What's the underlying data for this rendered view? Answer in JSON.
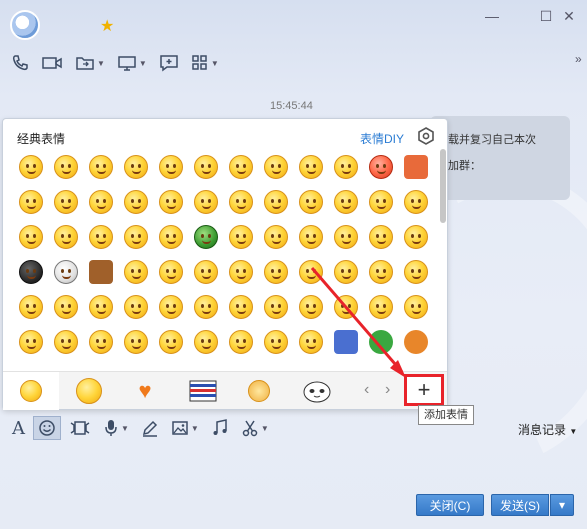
{
  "header": {
    "title": ""
  },
  "toolbar": {
    "more": "»"
  },
  "chat": {
    "timestamp": "15:45:44",
    "bubble_line1": "载并复习自己本次",
    "bubble_line2": "加群："
  },
  "emoji_panel": {
    "title": "经典表情",
    "diy_label": "表情DIY",
    "tooltip": "添加表情",
    "add_label": "+",
    "rows": [
      [
        "smile",
        "grin-shy",
        "heart-eyes",
        "grimace",
        "cool",
        "cry",
        "laugh",
        "bandage",
        "sleepy",
        "sweat",
        "angry-red",
        "gift"
      ],
      [
        "tongue",
        "big-grin",
        "dizzy",
        "worry",
        "sunglasses",
        "nervous",
        "devil",
        "yawn",
        "think",
        "shy",
        "hug",
        "wow"
      ],
      [
        "wink",
        "smug",
        "furious",
        "sweat-smile",
        "laugh-tears",
        "army-helmet",
        "ninja",
        "scream",
        "question",
        "shh",
        "spiral",
        "grumble"
      ],
      [
        "skull-bomb",
        "white-skull",
        "hammer",
        "sad",
        "sob",
        "peace",
        "frown",
        "stare",
        "puke",
        "blush",
        "kiss",
        "cheer"
      ],
      [
        "pout",
        "facepalm",
        "love",
        "sigh",
        "cold",
        "hungry",
        "sneeze",
        "crying",
        "pray",
        "ok",
        "clown",
        "sick"
      ],
      [
        "shrug",
        "squint",
        "slap",
        "bleed",
        "surprised",
        "shock",
        "look",
        "huh",
        "sweat-down",
        "book",
        "watermelon",
        "basketball"
      ]
    ],
    "tabs": [
      "classic",
      "yellow-face",
      "heart",
      "ticket",
      "dog",
      "panda"
    ]
  },
  "input_toolbar": {
    "history": "消息记录"
  },
  "buttons": {
    "close": "关闭(C)",
    "send": "发送(S)",
    "send_more": "▾"
  },
  "colors": {
    "accent": "#e8232a",
    "button": "#3579c8",
    "link": "#2b7cd3"
  }
}
